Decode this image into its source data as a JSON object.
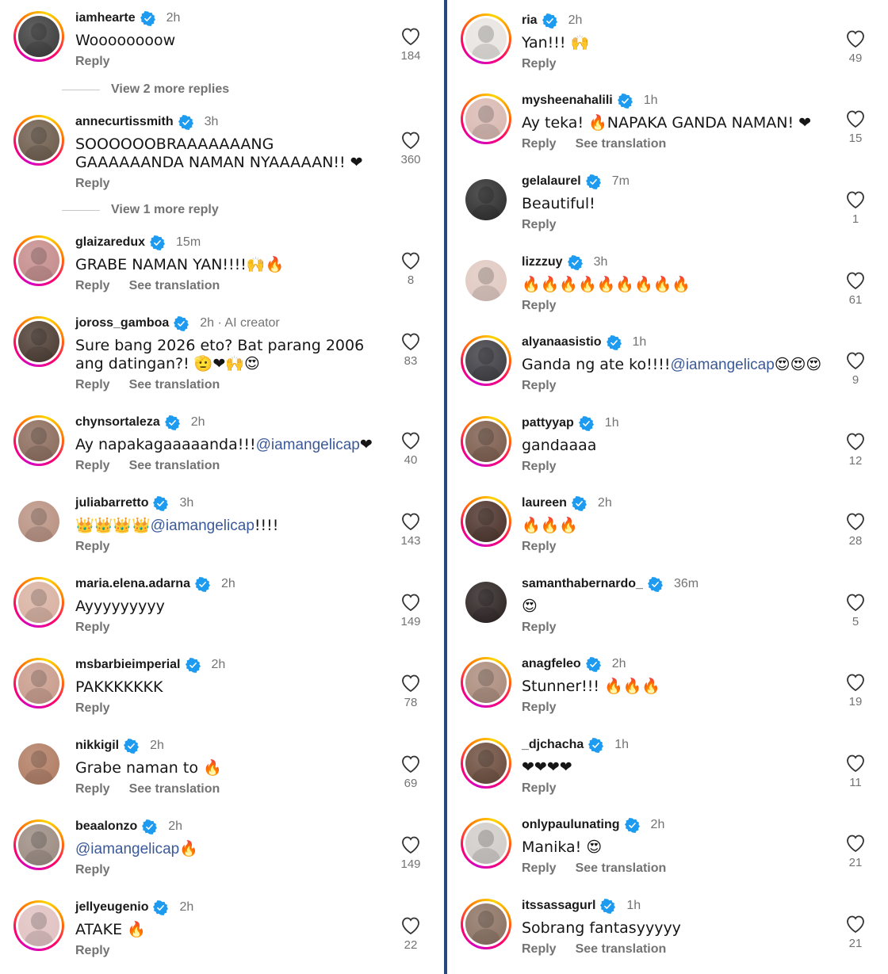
{
  "colors": {
    "verified": "#1d9bf0",
    "meta": "#737373",
    "mention": "#3b5998",
    "divider": "#27497d",
    "heart_outline": "#333333"
  },
  "labels": {
    "reply": "Reply",
    "see_translation": "See translation"
  },
  "left": {
    "comments": [
      {
        "username": "iamhearte",
        "time": "2h",
        "text": "Woooooooow",
        "likes": "184",
        "translation": false
      },
      {
        "username": "annecurtissmith",
        "time": "3h",
        "text": "SOOOOOOBRAAAAAAANG GAAAAAANDA NAMAN NYAAAAAN!! ❤",
        "likes": "360",
        "translation": false
      },
      {
        "username": "glaizaredux",
        "time": "15m",
        "text": "GRABE NAMAN YAN!!!!🙌🔥",
        "likes": "8",
        "translation": true
      },
      {
        "username": "joross_gamboa",
        "time": "2h · AI creator",
        "text": "Sure bang 2026 eto? Bat parang 2006 ang datingan?! 🫡❤🙌😍",
        "likes": "83",
        "translation": true
      },
      {
        "username": "chynsortaleza",
        "time": "2h",
        "text_pre": "Ay napakagaaaaanda!!! ",
        "mention": "@iamangelicap",
        "text_post": " ❤",
        "likes": "40",
        "translation": true
      },
      {
        "username": "juliabarretto",
        "time": "3h",
        "text_pre": "👑👑👑👑 ",
        "mention": "@iamangelicap",
        "text_post": "!!!!",
        "likes": "143",
        "translation": false
      },
      {
        "username": "maria.elena.adarna",
        "time": "2h",
        "text": "Ayyyyyyyyy",
        "likes": "149",
        "translation": false
      },
      {
        "username": "msbarbieimperial",
        "time": "2h",
        "text": "PAKKKKKKK",
        "likes": "78",
        "translation": false
      },
      {
        "username": "nikkigil",
        "time": "2h",
        "text": "Grabe naman to 🔥",
        "likes": "69",
        "translation": true
      },
      {
        "username": "beaalonzo",
        "time": "2h",
        "text_pre": "",
        "mention": "@iamangelicap",
        "text_post": " 🔥",
        "likes": "149",
        "translation": false
      },
      {
        "username": "jellyeugenio",
        "time": "2h",
        "text": "ATAKE 🔥",
        "likes": "22",
        "translation": false
      }
    ],
    "more_replies": [
      "View 2 more replies",
      "View 1 more reply"
    ]
  },
  "right": {
    "comments": [
      {
        "username": "ria",
        "time": "2h",
        "text": "Yan!!! 🙌",
        "likes": "49",
        "translation": false
      },
      {
        "username": "mysheenahalili",
        "time": "1h",
        "text": "Ay teka! 🔥NAPAKA GANDA NAMAN! ❤",
        "likes": "15",
        "translation": true
      },
      {
        "username": "gelalaurel",
        "time": "7m",
        "text": "Beautiful!",
        "likes": "1",
        "translation": false
      },
      {
        "username": "lizzzuy",
        "time": "3h",
        "text": "🔥🔥🔥🔥🔥🔥🔥🔥🔥",
        "likes": "61",
        "translation": false
      },
      {
        "username": "alyanaasistio",
        "time": "1h",
        "text_pre": "Ganda ng ate ko!!!! ",
        "mention": "@iamangelicap",
        "text_post": " 😍😍😍",
        "likes": "9",
        "translation": false
      },
      {
        "username": "pattyyap",
        "time": "1h",
        "text": "gandaaaa",
        "likes": "12",
        "translation": false
      },
      {
        "username": "laureen",
        "time": "2h",
        "text": "🔥🔥🔥",
        "likes": "28",
        "translation": false
      },
      {
        "username": "samanthabernardo_",
        "time": "36m",
        "text": "😍",
        "likes": "5",
        "translation": false
      },
      {
        "username": "anagfeleo",
        "time": "2h",
        "text": "Stunner!!! 🔥🔥🔥",
        "likes": "19",
        "translation": false
      },
      {
        "username": "_djchacha",
        "time": "1h",
        "text": "❤❤❤❤",
        "likes": "11",
        "translation": false
      },
      {
        "username": "onlypaulunating",
        "time": "2h",
        "text": "Manika! 😍",
        "likes": "21",
        "translation": true
      },
      {
        "username": "itssassagurl",
        "time": "1h",
        "text": "Sobrang fantasyyyyy",
        "likes": "21",
        "translation": true
      }
    ]
  }
}
